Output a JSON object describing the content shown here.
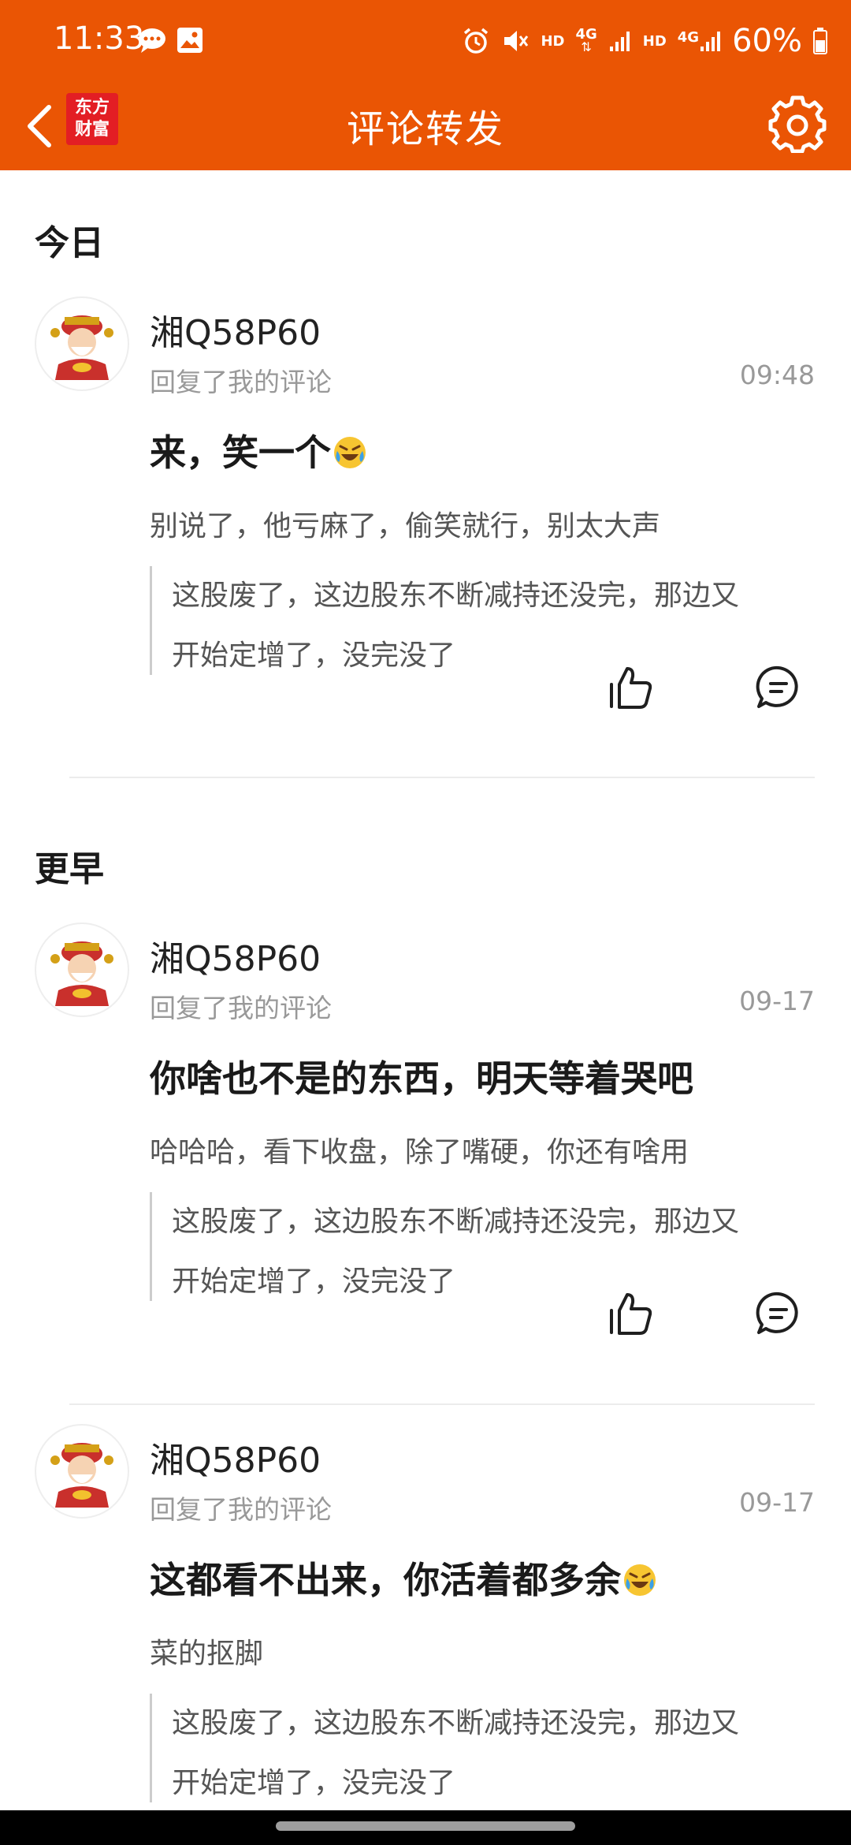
{
  "status_bar": {
    "time": "11:33",
    "battery": "60%",
    "hd1": "HD",
    "hd2": "HD",
    "net1": "4G",
    "net2": "4G"
  },
  "header": {
    "logo_line1": "东方",
    "logo_line2": "财富",
    "title": "评论转发"
  },
  "sections": [
    {
      "heading": "今日"
    },
    {
      "heading": "更早"
    }
  ],
  "comments": [
    {
      "username": "湘Q58P60",
      "action": "回复了我的评论",
      "time": "09:48",
      "content": "来，笑一个",
      "reply": "别说了，他亏麻了，偷笑就行，别太大声",
      "quote_line1": "这股废了，这边股东不断减持还没完，那边又",
      "quote_line2": "开始定增了，没完没了"
    },
    {
      "username": "湘Q58P60",
      "action": "回复了我的评论",
      "time": "09-17",
      "content": "你啥也不是的东西，明天等着哭吧",
      "reply": "哈哈哈，看下收盘，除了嘴硬，你还有啥用",
      "quote_line1": "这股废了，这边股东不断减持还没完，那边又",
      "quote_line2": "开始定增了，没完没了"
    },
    {
      "username": "湘Q58P60",
      "action": "回复了我的评论",
      "time": "09-17",
      "content": "这都看不出来，你活着都多余",
      "reply": "菜的抠脚",
      "quote_line1": "这股废了，这边股东不断减持还没完，那边又",
      "quote_line2": "开始定增了，没完没了"
    }
  ],
  "colors": {
    "brand": "#ea5504",
    "logo_red": "#e31e24"
  },
  "icons": [
    "back-icon",
    "gear-icon",
    "like-icon",
    "comment-icon",
    "laugh-emoji-icon"
  ]
}
